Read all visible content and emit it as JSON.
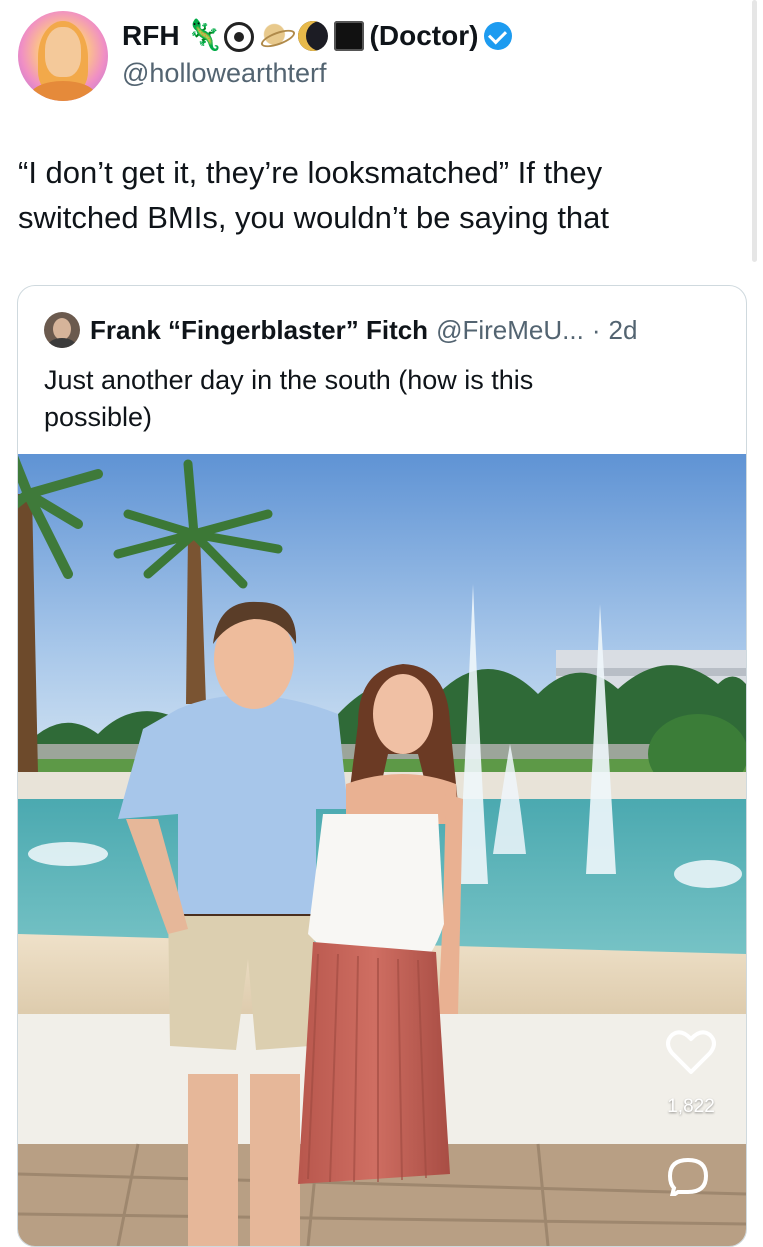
{
  "author": {
    "display_name": "RFH",
    "role_tag": "(Doctor)",
    "handle": "@hollowearthterf",
    "emoji_icons": [
      "lizard-icon",
      "eye-icon",
      "saturn-icon",
      "moon-icon",
      "black-square-icon"
    ],
    "verified": true
  },
  "tweet": {
    "text": "“I don’t get it, they’re looksmatched” If they\nswitched BMIs, you wouldn’t be saying that"
  },
  "quote": {
    "display_name": "Frank “Fingerblaster” Fitch",
    "handle": "@FireMeU...",
    "separator": "·",
    "time": "2d",
    "text": "Just another day in the south (how is this possible)",
    "media": {
      "like_count": "1,822"
    }
  },
  "colors": {
    "accent": "#1d9bf0",
    "text_primary": "#0f1419",
    "text_secondary": "#536471",
    "border": "#cfd9de"
  }
}
